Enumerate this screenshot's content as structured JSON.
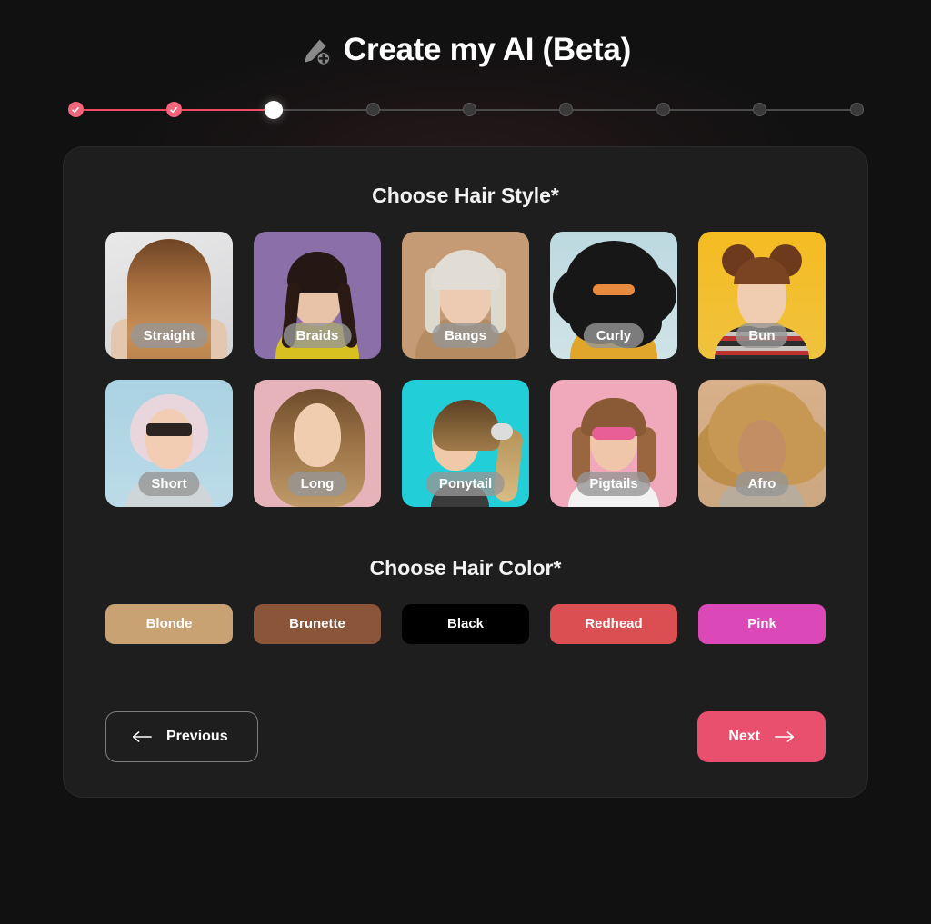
{
  "header": {
    "title": "Create my AI (Beta)",
    "icon": "pencil-plus-icon"
  },
  "stepper": {
    "total_steps": 9,
    "current_step": 3,
    "completed_steps": 2,
    "steps": [
      {
        "state": "done"
      },
      {
        "state": "done"
      },
      {
        "state": "active"
      },
      {
        "state": "todo"
      },
      {
        "state": "todo"
      },
      {
        "state": "todo"
      },
      {
        "state": "todo"
      },
      {
        "state": "todo"
      },
      {
        "state": "todo"
      }
    ],
    "colors": {
      "done": "#F4647B",
      "done_line": "#F04A63",
      "active": "#FFFFFF",
      "todo": "#3A3A3A",
      "todo_line": "#4A4A4A"
    }
  },
  "hair_style": {
    "title": "Choose Hair Style*",
    "options": [
      {
        "label": "Straight",
        "art": "p-straight"
      },
      {
        "label": "Braids",
        "art": "p-braids"
      },
      {
        "label": "Bangs",
        "art": "p-bangs"
      },
      {
        "label": "Curly",
        "art": "p-curly"
      },
      {
        "label": "Bun",
        "art": "p-bun"
      },
      {
        "label": "Short",
        "art": "p-short"
      },
      {
        "label": "Long",
        "art": "p-long"
      },
      {
        "label": "Ponytail",
        "art": "p-ponytail"
      },
      {
        "label": "Pigtails",
        "art": "p-pigtails"
      },
      {
        "label": "Afro",
        "art": "p-afro"
      }
    ]
  },
  "hair_color": {
    "title": "Choose Hair Color*",
    "options": [
      {
        "label": "Blonde",
        "swatch": "#C9A273"
      },
      {
        "label": "Brunette",
        "swatch": "#8B5539"
      },
      {
        "label": "Black",
        "swatch": "#000000"
      },
      {
        "label": "Redhead",
        "swatch": "#DB4F52"
      },
      {
        "label": "Pink",
        "swatch": "#DB48B8"
      }
    ]
  },
  "footer": {
    "previous_label": "Previous",
    "next_label": "Next",
    "previous_icon": "arrow-left-icon",
    "next_icon": "arrow-right-icon",
    "next_color": "#E8506E"
  },
  "theme": {
    "page_background": "#111111",
    "panel_background": "#1E1E1E",
    "accent": "#E8506E"
  }
}
